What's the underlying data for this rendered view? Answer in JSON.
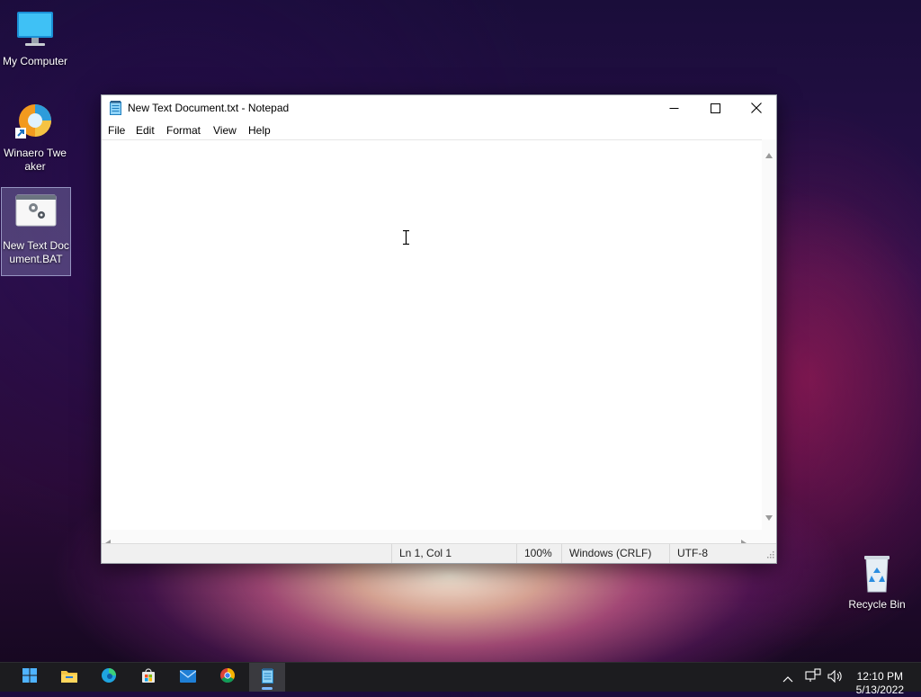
{
  "desktop": {
    "icons": [
      {
        "label": "My Computer"
      },
      {
        "label": "Winaero Tweaker"
      },
      {
        "label": "New Text Document.BAT"
      },
      {
        "label": "Recycle Bin"
      }
    ]
  },
  "window": {
    "title": "New Text Document.txt - Notepad",
    "menu": [
      "File",
      "Edit",
      "Format",
      "View",
      "Help"
    ],
    "content": "",
    "status": {
      "position": "Ln 1, Col 1",
      "zoom": "100%",
      "line_ending": "Windows (CRLF)",
      "encoding": "UTF-8"
    }
  },
  "taskbar": {
    "apps": [
      "start",
      "file-explorer",
      "edge",
      "store",
      "mail",
      "chrome",
      "notepad"
    ],
    "active_app": "notepad",
    "clock": {
      "time": "12:10 PM",
      "date": "5/13/2022"
    }
  },
  "colors": {
    "accent": "#0078d4",
    "taskbar": "#1c1c1f",
    "statusbar": "#f0f0f0"
  }
}
